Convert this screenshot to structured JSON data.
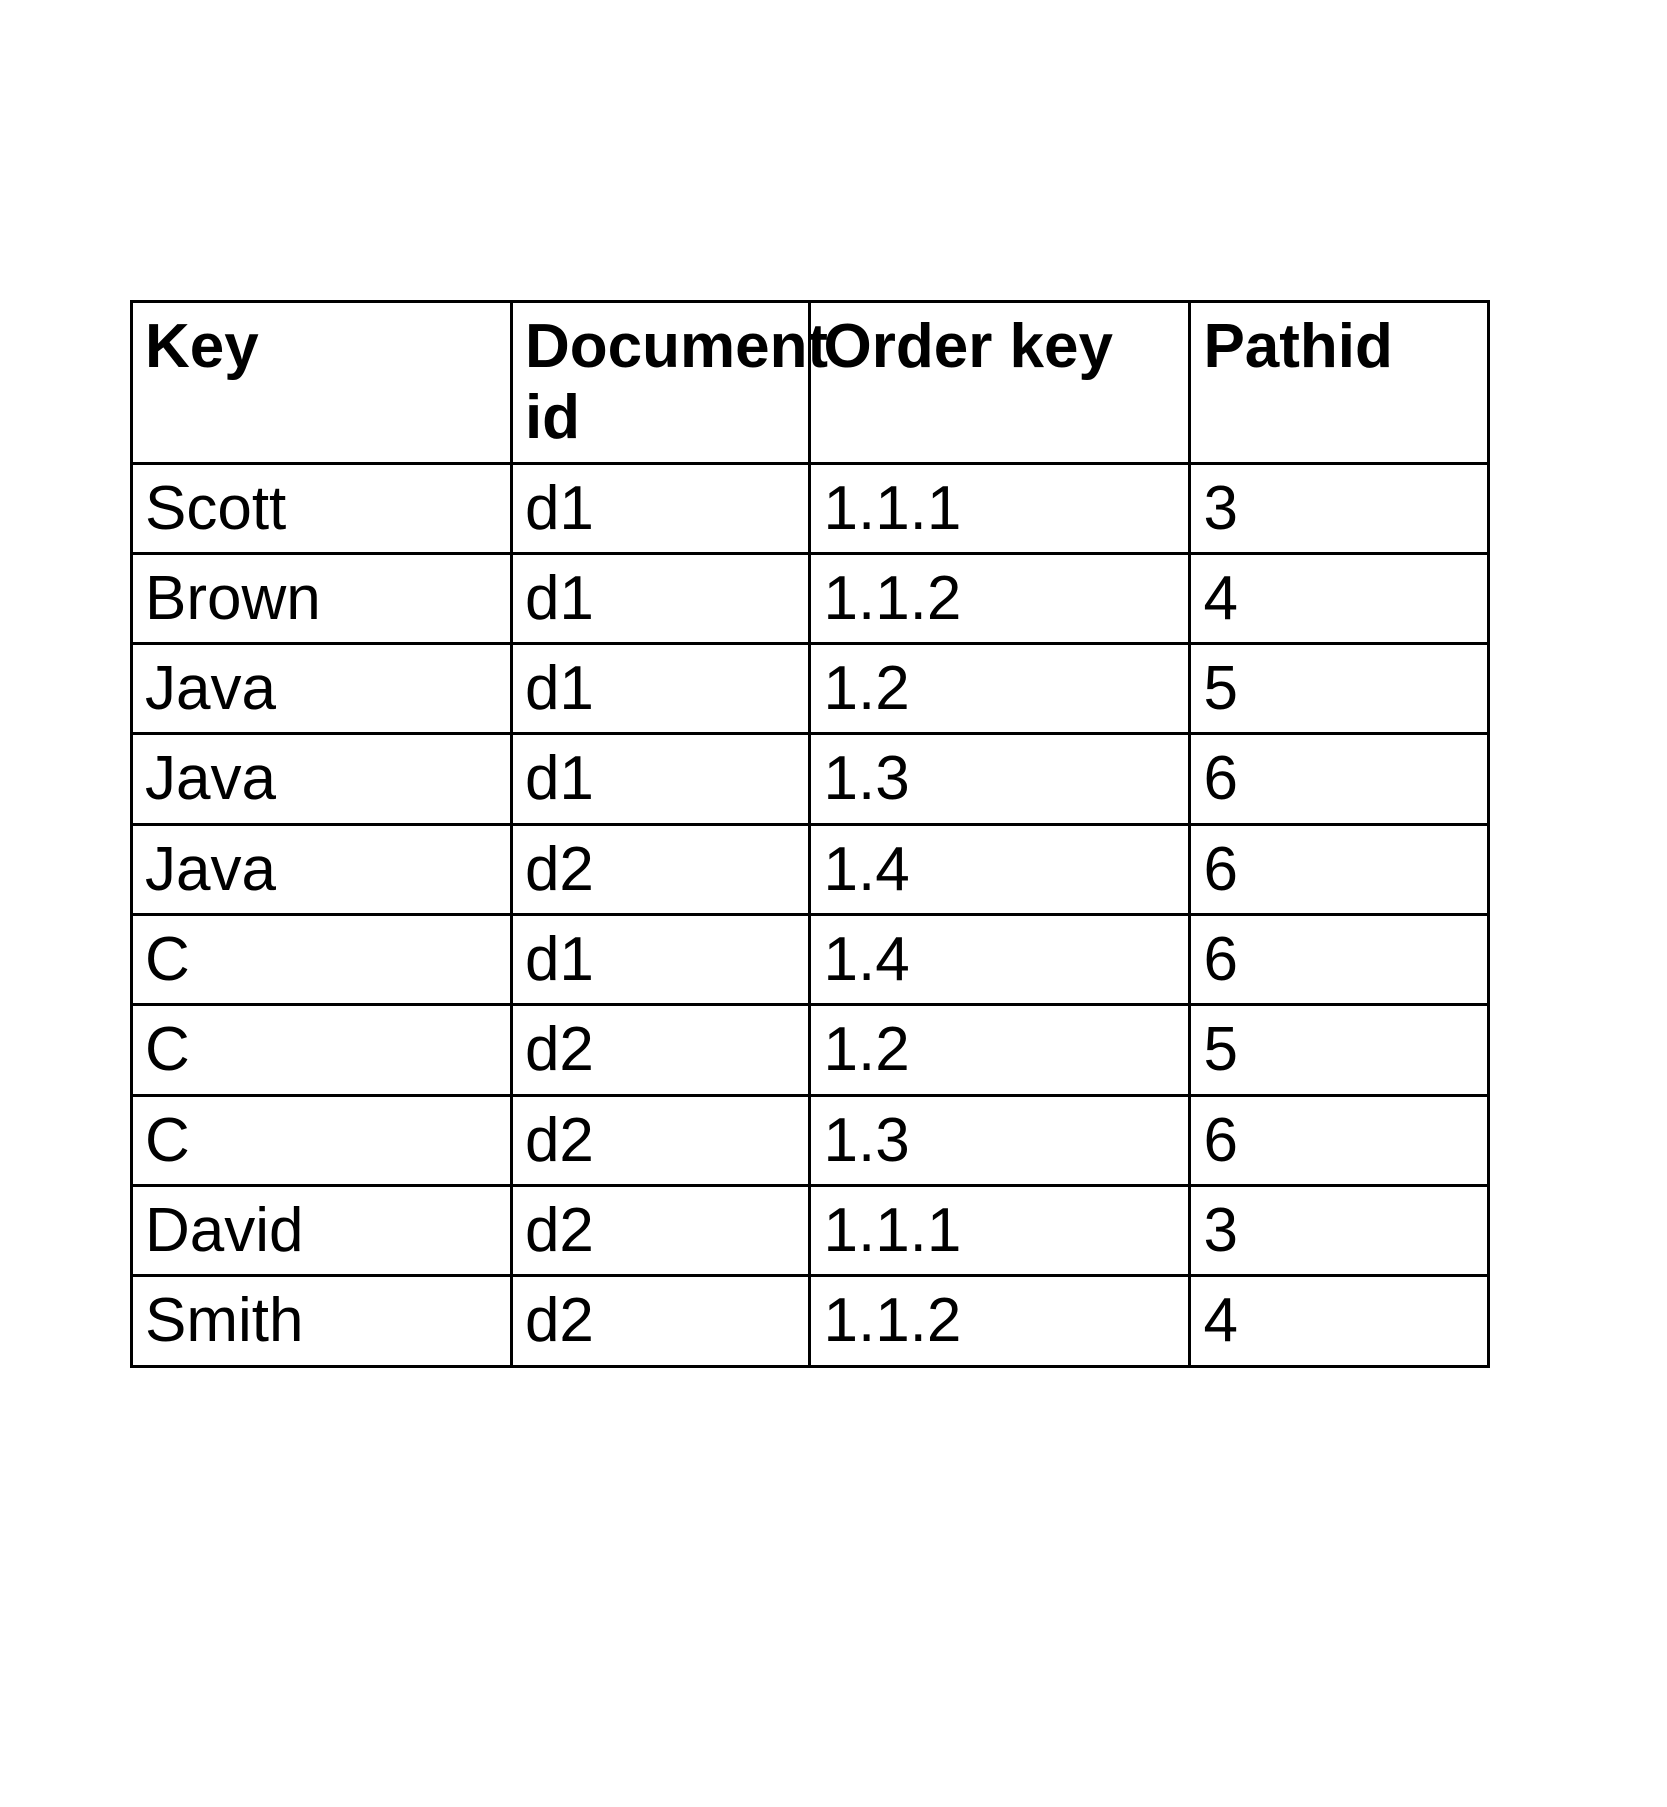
{
  "table": {
    "headers": {
      "key": "Key",
      "document_id": "Document id",
      "order_key": "Order key",
      "pathid": "Pathid"
    },
    "rows": [
      {
        "key": "Scott",
        "document_id": "d1",
        "order_key": "1.1.1",
        "pathid": "3"
      },
      {
        "key": "Brown",
        "document_id": "d1",
        "order_key": "1.1.2",
        "pathid": "4"
      },
      {
        "key": "Java",
        "document_id": "d1",
        "order_key": "1.2",
        "pathid": "5"
      },
      {
        "key": "Java",
        "document_id": "d1",
        "order_key": "1.3",
        "pathid": "6"
      },
      {
        "key": "Java",
        "document_id": "d2",
        "order_key": "1.4",
        "pathid": "6"
      },
      {
        "key": "C",
        "document_id": "d1",
        "order_key": "1.4",
        "pathid": "6"
      },
      {
        "key": "C",
        "document_id": "d2",
        "order_key": "1.2",
        "pathid": "5"
      },
      {
        "key": "C",
        "document_id": "d2",
        "order_key": "1.3",
        "pathid": "6"
      },
      {
        "key": "David",
        "document_id": "d2",
        "order_key": "1.1.1",
        "pathid": "3"
      },
      {
        "key": "Smith",
        "document_id": "d2",
        "order_key": "1.1.2",
        "pathid": "4"
      }
    ]
  }
}
